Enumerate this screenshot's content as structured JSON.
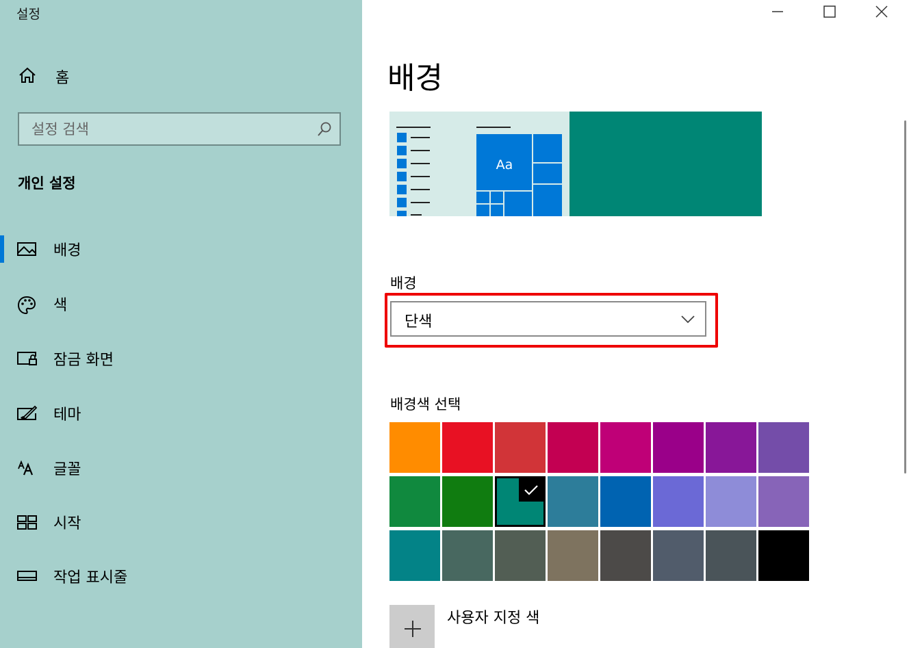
{
  "window": {
    "title": "설정"
  },
  "sidebar": {
    "home_label": "홈",
    "search": {
      "placeholder": "설정 검색"
    },
    "section_title": "개인 설정",
    "items": [
      {
        "label": "배경",
        "icon": "picture-icon",
        "selected": true
      },
      {
        "label": "색",
        "icon": "palette-icon",
        "selected": false
      },
      {
        "label": "잠금 화면",
        "icon": "lock-screen-icon",
        "selected": false
      },
      {
        "label": "테마",
        "icon": "theme-brush-icon",
        "selected": false
      },
      {
        "label": "글꼴",
        "icon": "font-icon",
        "selected": false
      },
      {
        "label": "시작",
        "icon": "start-grid-icon",
        "selected": false
      },
      {
        "label": "작업 표시줄",
        "icon": "taskbar-icon",
        "selected": false
      }
    ]
  },
  "main": {
    "title": "배경",
    "preview": {
      "tile_text": "Aa",
      "background_color": "#008675"
    },
    "background_label": "배경",
    "background_value": "단색",
    "color_section_label": "배경색 선택",
    "colors": [
      "#ff8c00",
      "#e81123",
      "#d13438",
      "#c30052",
      "#bf0077",
      "#9a0089",
      "#881798",
      "#744da9",
      "#10893e",
      "#107c10",
      "#008675",
      "#2d7d9a",
      "#0063b1",
      "#6b69d6",
      "#8e8cd8",
      "#8764b8",
      "#038387",
      "#486860",
      "#525e54",
      "#7e735f",
      "#4c4a48",
      "#515c6b",
      "#4a5459",
      "#000000"
    ],
    "selected_color_index": 10,
    "custom_color_label": "사용자 지정 색"
  },
  "colors": {
    "sidebar_bg": "#a6d0cc",
    "accent": "#0078d7",
    "highlight": "#ee0000"
  }
}
